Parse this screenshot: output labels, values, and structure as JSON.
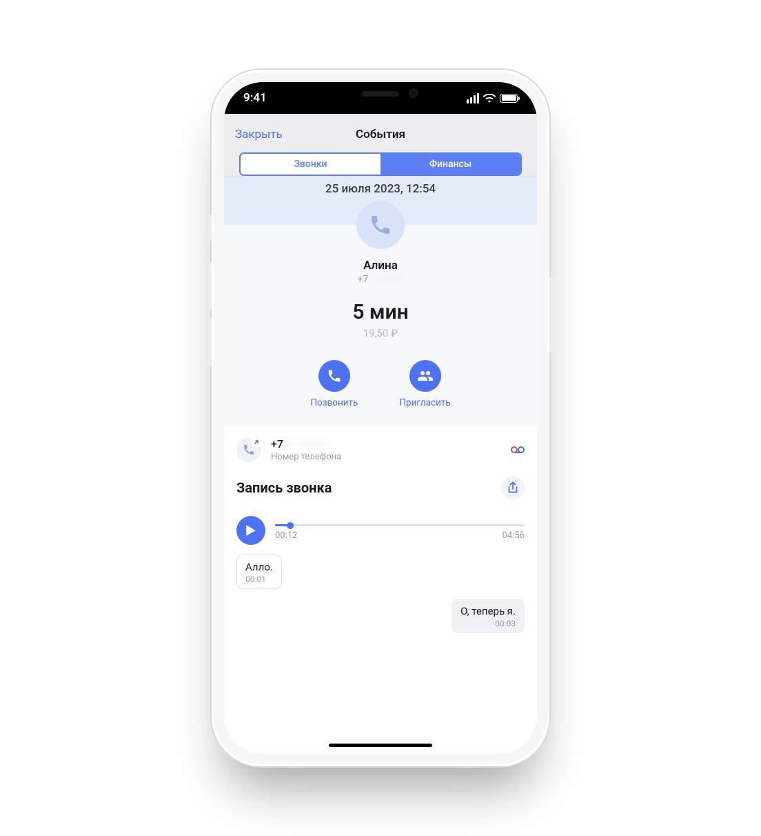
{
  "status": {
    "time": "9:41"
  },
  "header": {
    "close": "Закрыть",
    "title": "События",
    "tabs": {
      "calls": "Звонки",
      "finance": "Финансы"
    }
  },
  "call": {
    "datetime": "25 июля 2023, 12:54",
    "name": "Алина",
    "phone_prefix": "+7",
    "phone_masked": " ··· ···-··-··",
    "duration": "5 мин",
    "cost": "19,50 ₽",
    "actions": {
      "call": "Позвонить",
      "invite": "Пригласить"
    }
  },
  "number_row": {
    "phone_prefix": "+7",
    "phone_masked": " ··· ···-··-··",
    "sub": "Номер телефона"
  },
  "recording": {
    "title": "Запись звонка",
    "elapsed": "00:12",
    "total": "04:56",
    "progress_pct": 6
  },
  "transcript": [
    {
      "side": "left",
      "text": "Алло.",
      "time": "00:01"
    },
    {
      "side": "right",
      "text": "О, теперь я.",
      "time": "00:03"
    }
  ]
}
